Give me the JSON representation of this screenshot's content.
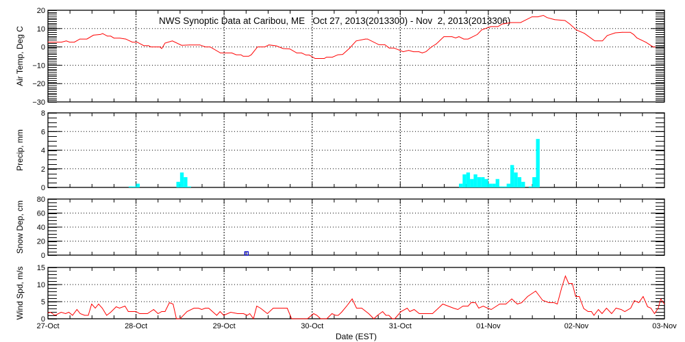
{
  "chart_data": [
    {
      "type": "line",
      "title": "NWS Synoptic Data at Caribou, ME   Oct 27, 2013(2013300) - Nov  2, 2013(2013306)",
      "ylabel": "Air Temp, Deg C",
      "ylim": [
        -30,
        20
      ],
      "yticks": [
        -30,
        -20,
        -10,
        0,
        10,
        20
      ],
      "minor_step": 1,
      "color": "#ff0000",
      "x_hours": [
        0,
        3.7,
        5.0,
        5.9,
        7.2,
        8.7,
        10.6,
        12.4,
        14.3,
        14.9,
        16.2,
        17.1,
        18.0,
        19.6,
        21.2,
        23.0,
        24.3,
        26.1,
        27.4,
        28,
        30.5,
        31.0,
        31.9,
        33.9,
        36.4,
        38.6,
        41.4,
        42.9,
        44.2,
        47.0,
        50.1,
        51.3,
        52.6,
        53.2,
        54.7,
        55.4,
        57.1,
        59.1,
        60.2,
        62.2,
        64.1,
        65.9,
        67.8,
        69.1,
        70.3,
        71.2,
        72.8,
        75.3,
        75.9,
        77.5,
        79.0,
        80.3,
        82.1,
        84.0,
        86.5,
        87.1,
        90.2,
        91.8,
        93.0,
        94.3,
        96.8,
        98.3,
        99.6,
        101.1,
        102.0,
        103.0,
        104.5,
        105.8,
        107.9,
        110.1,
        111.1,
        112.0,
        113.3,
        114.5,
        117.0,
        118.2,
        120.7,
        122.6,
        123.8,
        126.3,
        128.8,
        131.9,
        133.5,
        135.0,
        136.0,
        138.1,
        140.9,
        142.2,
        144.0,
        146.2,
        149.0,
        151.1,
        152.4,
        154.6,
        156.5,
        158.7,
        159.6,
        160.5,
        163.0,
        164.9,
        165.5
      ],
      "values": [
        2.6,
        2.6,
        3.3,
        2.6,
        2.6,
        4.3,
        4.3,
        6.4,
        6.8,
        7.3,
        5.9,
        5.9,
        4.8,
        4.8,
        4.3,
        2.6,
        2.6,
        0.7,
        0.7,
        0,
        0,
        -0.9,
        2.1,
        3.3,
        0.9,
        1.1,
        1.1,
        0,
        0,
        -3.3,
        -3.3,
        -4.3,
        -4.3,
        -5.1,
        -5.1,
        -4.3,
        0,
        0,
        1.1,
        0.6,
        -0.9,
        -1.1,
        -3.3,
        -3.3,
        -4.4,
        -4.4,
        -6.3,
        -6.3,
        -5.6,
        -5.6,
        -4.3,
        -4.1,
        -0.9,
        3.3,
        4.3,
        4.3,
        1.2,
        1.2,
        -0.6,
        -0.6,
        -2.6,
        -1.9,
        -2.6,
        -2.6,
        -3.3,
        -2.6,
        0,
        1.6,
        5.6,
        5.6,
        4.9,
        5.6,
        4.3,
        4.3,
        6.8,
        9.3,
        11.1,
        11.1,
        12.5,
        13.3,
        13.3,
        16.4,
        16.4,
        17.2,
        16,
        14.9,
        14.4,
        12.5,
        9.3,
        7.4,
        3.3,
        3.3,
        6.2,
        7.7,
        8,
        8,
        6.8,
        4.9,
        2.5,
        0,
        0
      ]
    },
    {
      "type": "bar",
      "ylabel": "Precip, mm",
      "ylim": [
        0,
        8
      ],
      "yticks": [
        0,
        2,
        4,
        6,
        8
      ],
      "minor_step": 0.5,
      "color": "#00ffff",
      "x_hours": [
        22,
        23,
        24,
        35,
        36,
        37,
        38,
        112,
        113,
        114,
        115,
        116,
        117,
        118,
        119,
        120,
        121,
        122,
        123,
        124,
        125,
        126,
        127,
        128,
        129,
        131,
        132,
        133
      ],
      "values": [
        0.1,
        0.1,
        0.4,
        0.6,
        1.6,
        1.1,
        0.1,
        0.4,
        1.4,
        1.6,
        0.9,
        1.4,
        1.1,
        1.1,
        0.9,
        0.4,
        0.4,
        0.9,
        0.1,
        0.1,
        0.4,
        2.4,
        1.6,
        1.1,
        0.6,
        0.1,
        1.1,
        5.2
      ]
    },
    {
      "type": "scatter",
      "ylabel": "Snow Dep, cm",
      "ylim": [
        0,
        80
      ],
      "yticks": [
        0,
        20,
        40,
        60,
        80
      ],
      "minor_step": 5,
      "color": "#0000cc",
      "x_hours": [
        54.1
      ],
      "values": [
        0
      ]
    },
    {
      "type": "line",
      "ylabel": "Wind Spd, m/s",
      "ylim": [
        0,
        15
      ],
      "yticks": [
        0,
        5,
        10,
        15
      ],
      "minor_step": 1,
      "color": "#ff0000",
      "x_hours": [
        0,
        0.7,
        1.9,
        3.6,
        4.8,
        5.7,
        6.7,
        7.9,
        8.8,
        10,
        11,
        11.9,
        12.9,
        13.8,
        14.8,
        16,
        17.1,
        18.6,
        19.5,
        21,
        21.9,
        24,
        25,
        27.1,
        28.8,
        30,
        31,
        31.9,
        33.1,
        34.1,
        35,
        36,
        37.9,
        39.8,
        41,
        41.9,
        42.9,
        43.8,
        46,
        46.9,
        47.9,
        49.8,
        51.7,
        53.3,
        54.3,
        55,
        56,
        56.9,
        57.9,
        59.8,
        61.4,
        65.2,
        66.4,
        70.7,
        72.4,
        73.3,
        74.3,
        76,
        77.4,
        78.4,
        79.1,
        80,
        81.4,
        82.9,
        84.1,
        85.5,
        87.4,
        88.8,
        89.8,
        91.2,
        92.1,
        92.9,
        93.8,
        94.5,
        96.2,
        97.9,
        98.6,
        99.8,
        101.2,
        103.4,
        104.8,
        107.6,
        110.5,
        111.7,
        113.1,
        114.5,
        115.3,
        116.5,
        117.4,
        118.6,
        119.8,
        120.8,
        123.1,
        124.8,
        126.4,
        127.9,
        129.1,
        130.7,
        132.9,
        134.8,
        136.5,
        137.9,
        138.8,
        140,
        141,
        141.9,
        142.9,
        143.8,
        144.8,
        146,
        147.2,
        148.1,
        148.8,
        150,
        151,
        152.2,
        153.6,
        154.8,
        156.2,
        157.2,
        158.8,
        159.8,
        161,
        162.2,
        163.4,
        164.3,
        165.3,
        166.3,
        167,
        168
      ],
      "values": [
        1.7,
        1.9,
        1.0,
        1.9,
        1.5,
        1.9,
        1.0,
        2.7,
        1.5,
        1.0,
        1.0,
        4.3,
        3.1,
        4.3,
        3.1,
        1.0,
        1.9,
        3.5,
        3.1,
        3.7,
        2.1,
        2.1,
        1.5,
        1.5,
        2.7,
        1.5,
        2.1,
        2.1,
        4.7,
        4.3,
        0,
        0,
        2.1,
        3.1,
        3.1,
        2.7,
        3.1,
        3.1,
        1.0,
        2.1,
        1.0,
        1.9,
        1.5,
        1.5,
        1.0,
        1.5,
        0,
        3.7,
        3.1,
        1.5,
        3.1,
        3.1,
        0,
        0,
        1.5,
        1.0,
        0,
        0,
        1.5,
        1.0,
        1.0,
        1.9,
        3.7,
        5.8,
        3.1,
        3.1,
        1.5,
        0,
        1.0,
        2.1,
        1.0,
        1.0,
        0,
        0,
        2.1,
        3.1,
        2.1,
        2.7,
        1.5,
        1.5,
        1.5,
        4.3,
        3.1,
        2.7,
        3.7,
        3.7,
        4.7,
        4.7,
        3.1,
        3.7,
        3.1,
        2.7,
        4.3,
        4.3,
        5.8,
        4.3,
        4.7,
        6.5,
        8.1,
        5.4,
        4.7,
        4.7,
        4.3,
        9.1,
        12.5,
        10.3,
        10.3,
        6.5,
        6.5,
        3.0,
        2.1,
        2.1,
        1.0,
        2.7,
        1.5,
        3.1,
        1.5,
        3.1,
        2.7,
        2.1,
        3.1,
        5.3,
        4.7,
        6.5,
        3.5,
        3.1,
        1.5,
        3.1,
        5.8,
        4.3
      ]
    }
  ],
  "x_axis": {
    "label": "Date (EST)",
    "range_hours": [
      0,
      168
    ],
    "tick_labels": [
      "27-Oct",
      "28-Oct",
      "29-Oct",
      "30-Oct",
      "31-Oct",
      "01-Nov",
      "02-Nov",
      "03-Nov"
    ]
  }
}
